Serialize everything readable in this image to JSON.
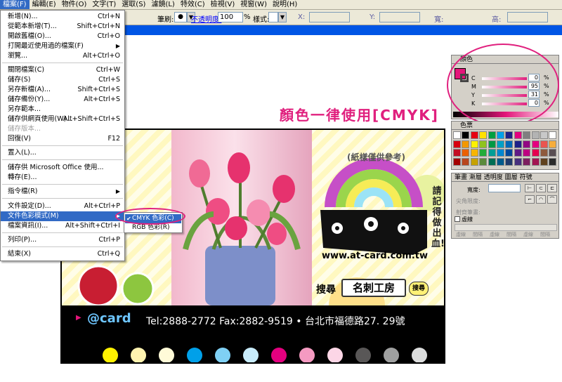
{
  "menubar": {
    "items": [
      "檔案(F)",
      "編輯(E)",
      "物件(O)",
      "文字(T)",
      "選取(S)",
      "濾鏡(L)",
      "特效(C)",
      "檢視(V)",
      "視窗(W)",
      "說明(H)"
    ]
  },
  "optionbar": {
    "brush_label": "筆刷:",
    "opacity_label": "不透明度:",
    "opacity_value": "100",
    "percent": "%",
    "style_label": "樣式:",
    "x_label": "X:",
    "y_label": "Y:",
    "w_label": "寬:",
    "h_label": "高:"
  },
  "file_menu": {
    "items": [
      {
        "label": "新增(N)...",
        "shortcut": "Ctrl+N"
      },
      {
        "label": "從範本新增(T)...",
        "shortcut": "Shift+Ctrl+N"
      },
      {
        "label": "開啟舊檔(O)...",
        "shortcut": "Ctrl+O"
      },
      {
        "label": "打開最近使用過的檔案(F)",
        "shortcut": ""
      },
      {
        "label": "瀏覽...",
        "shortcut": "Alt+Ctrl+O"
      },
      {
        "label": "關閉檔案(C)",
        "shortcut": "Ctrl+W"
      },
      {
        "label": "儲存(S)",
        "shortcut": "Ctrl+S"
      },
      {
        "label": "另存新檔(A)...",
        "shortcut": "Shift+Ctrl+S"
      },
      {
        "label": "儲存備份(Y)...",
        "shortcut": "Alt+Ctrl+S"
      },
      {
        "label": "另存範本...",
        "shortcut": ""
      },
      {
        "label": "儲存供網頁使用(W)...",
        "shortcut": "Alt+Shift+Ctrl+S"
      },
      {
        "label": "儲存版本...",
        "shortcut": ""
      },
      {
        "label": "回復(V)",
        "shortcut": "F12"
      },
      {
        "label": "置入(L)...",
        "shortcut": ""
      },
      {
        "label": "儲存供 Microsoft Office 使用...",
        "shortcut": ""
      },
      {
        "label": "轉存(E)...",
        "shortcut": ""
      },
      {
        "label": "指令檔(R)",
        "shortcut": ""
      },
      {
        "label": "文件設定(D)...",
        "shortcut": "Alt+Ctrl+P"
      },
      {
        "label": "文件色彩模式(M)",
        "shortcut": ""
      },
      {
        "label": "檔案資訊(I)...",
        "shortcut": "Alt+Shift+Ctrl+I"
      },
      {
        "label": "列印(P)...",
        "shortcut": "Ctrl+P"
      },
      {
        "label": "結束(X)",
        "shortcut": "Ctrl+Q"
      }
    ]
  },
  "color_mode_submenu": {
    "items": [
      "CMYK 色彩(C)",
      "RGB 色彩(R)"
    ],
    "check": "✔"
  },
  "canvas": {
    "headline": "顏色一律使用[CMYK]",
    "card": {
      "sample_note": "(紙樣僅供參考)",
      "url": "www.at-card.com.tw",
      "bleed_note": "請記得做出血!",
      "search_label": "搜尋",
      "search_term": "名刺工房",
      "search_button": "搜尋",
      "logo": "@card",
      "contact": "Tel:2888-2772  Fax:2882-9519  • 台北市福德路27. 29號",
      "dot_colors": [
        "#fff200",
        "#fff3b0",
        "#fffbd8",
        "#00a0e9",
        "#7fd0f4",
        "#c8ecfb",
        "#e4007f",
        "#f49ac1",
        "#fcd6e6",
        "#595757",
        "#9fa0a0",
        "#dcdddd"
      ]
    }
  },
  "color_panel": {
    "title": "顏色",
    "channels": [
      {
        "label": "C",
        "value": "0",
        "unit": "%"
      },
      {
        "label": "M",
        "value": "95",
        "unit": "%"
      },
      {
        "label": "Y",
        "value": "31",
        "unit": "%"
      },
      {
        "label": "K",
        "value": "0",
        "unit": "%"
      }
    ],
    "fill_color": "#e4157a"
  },
  "swatches_panel": {
    "title": "色票",
    "colors": [
      "#ffffff",
      "#000000",
      "#e60012",
      "#ffe100",
      "#00a040",
      "#00a0e9",
      "#1d2088",
      "#e4007f",
      "#7f7f7f",
      "#b3b3b3",
      "#c8c8c8",
      "#ffffff",
      "#d7000f",
      "#f39800",
      "#fff100",
      "#8fc31f",
      "#009944",
      "#00a0c6",
      "#0068b7",
      "#1d2088",
      "#920783",
      "#e4007f",
      "#ea5550",
      "#f6ad3c",
      "#c30d23",
      "#eb6100",
      "#f8b500",
      "#22ac38",
      "#009e96",
      "#0086d1",
      "#00479d",
      "#601986",
      "#be0081",
      "#e5004f",
      "#8f5a3c",
      "#594e52",
      "#a40000",
      "#b9461d",
      "#c7a200",
      "#5a8a3a",
      "#006e54",
      "#005a8c",
      "#1f3a6d",
      "#462f7d",
      "#7d1e5f",
      "#a31451",
      "#60411e",
      "#2b2b2b"
    ]
  },
  "stroke_panel": {
    "tabs": [
      "筆畫",
      "漸層",
      "透明度",
      "圖層",
      "符號",
      "特效"
    ],
    "weight_label": "寬度:",
    "miter_label": "尖角限度:",
    "dashed_label": "虛線",
    "dash_labels": [
      "虛線",
      "間隔",
      "虛線",
      "間隔",
      "虛線",
      "間隔"
    ],
    "cap_label": "射齊筆畫:"
  }
}
